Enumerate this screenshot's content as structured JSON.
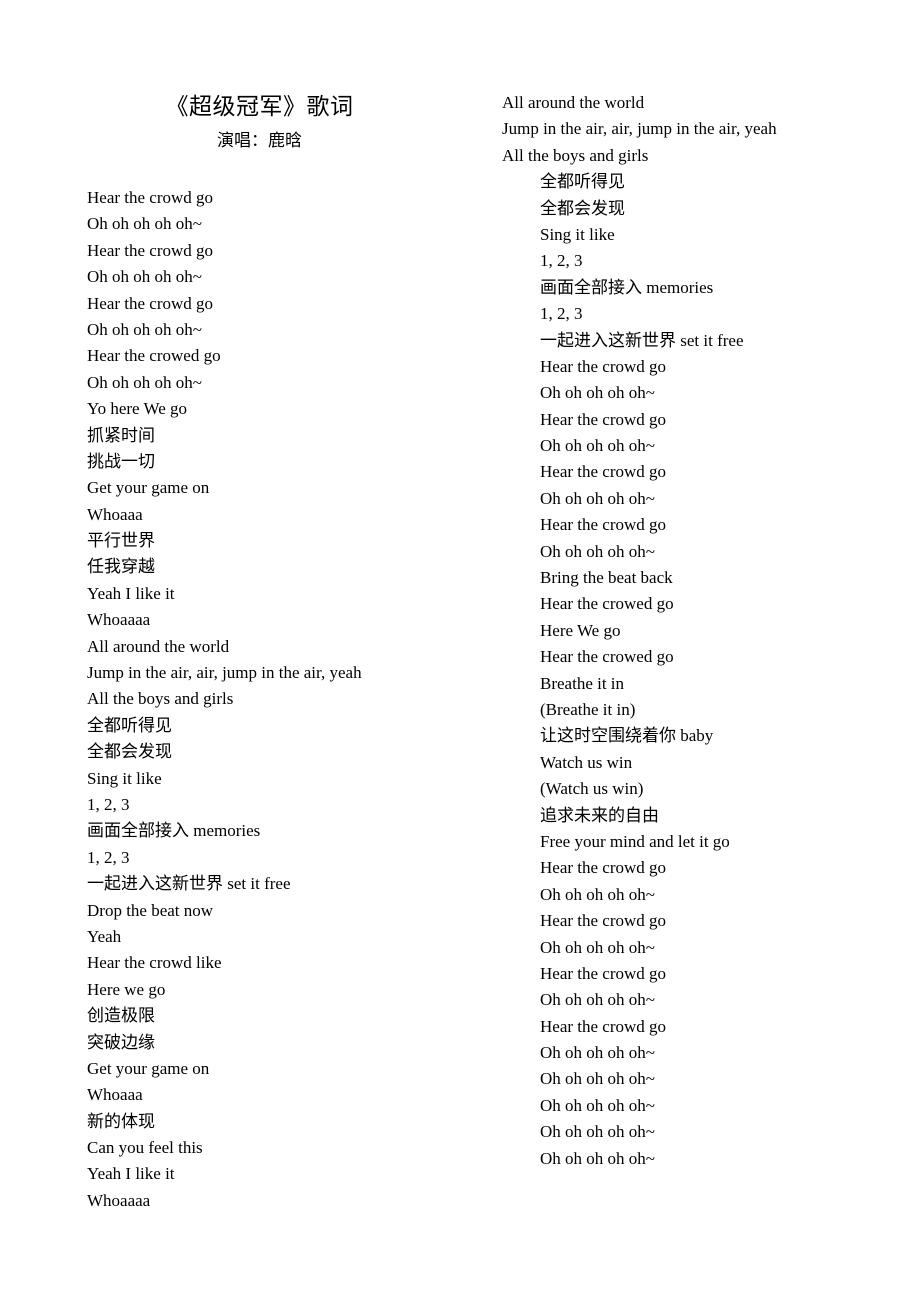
{
  "document": {
    "title": "《超级冠军》歌词",
    "subtitle": "演唱：鹿晗",
    "background_color": "#ffffff",
    "text_color": "#000000"
  },
  "left_column": {
    "lines": [
      {
        "text": "Hear the crowd go",
        "indent": false
      },
      {
        "text": "Oh oh oh oh oh~",
        "indent": false
      },
      {
        "text": "Hear the crowd go",
        "indent": false
      },
      {
        "text": "Oh oh oh oh oh~",
        "indent": false
      },
      {
        "text": "Hear the crowd go",
        "indent": false
      },
      {
        "text": "Oh oh oh oh oh~",
        "indent": false
      },
      {
        "text": "Hear the crowed go",
        "indent": false
      },
      {
        "text": "Oh oh oh oh oh~",
        "indent": false
      },
      {
        "text": "Yo here We go",
        "indent": false
      },
      {
        "text": "抓紧时间",
        "indent": false
      },
      {
        "text": "挑战一切",
        "indent": false
      },
      {
        "text": "Get your game on",
        "indent": false
      },
      {
        "text": "Whoaaa",
        "indent": false
      },
      {
        "text": "平行世界",
        "indent": false
      },
      {
        "text": "任我穿越",
        "indent": false
      },
      {
        "text": "Yeah I like it",
        "indent": false
      },
      {
        "text": "Whoaaaa",
        "indent": false
      },
      {
        "text": "All around the world",
        "indent": false
      },
      {
        "text": "Jump in the air, air, jump in the air, yeah",
        "indent": false
      },
      {
        "text": "All the boys and girls",
        "indent": false
      },
      {
        "text": "全都听得见",
        "indent": false
      },
      {
        "text": "全都会发现",
        "indent": false
      },
      {
        "text": "Sing it like",
        "indent": false
      },
      {
        "text": "1, 2, 3",
        "indent": false
      },
      {
        "text": "画面全部接入 memories",
        "indent": false
      },
      {
        "text": "1, 2, 3",
        "indent": false
      },
      {
        "text": "一起进入这新世界  set it free",
        "indent": false
      },
      {
        "text": "Drop the beat now",
        "indent": false
      },
      {
        "text": "Yeah",
        "indent": false
      },
      {
        "text": "Hear the crowd like",
        "indent": false
      },
      {
        "text": "Here we go",
        "indent": false
      },
      {
        "text": "创造极限",
        "indent": false
      },
      {
        "text": "突破边缘",
        "indent": false
      },
      {
        "text": "Get your game on",
        "indent": false
      },
      {
        "text": "Whoaaa",
        "indent": false
      },
      {
        "text": "新的体现",
        "indent": false
      },
      {
        "text": "Can you feel this",
        "indent": false
      },
      {
        "text": "Yeah I like it",
        "indent": false
      },
      {
        "text": "Whoaaaa",
        "indent": false
      }
    ]
  },
  "right_column": {
    "lines": [
      {
        "text": "All around the world",
        "indent": false
      },
      {
        "text": "Jump in the air, air, jump in the air, yeah",
        "indent": false
      },
      {
        "text": "All the boys and girls",
        "indent": false
      },
      {
        "text": "全都听得见",
        "indent": true
      },
      {
        "text": "全都会发现",
        "indent": true
      },
      {
        "text": "Sing it like",
        "indent": true
      },
      {
        "text": "1, 2, 3",
        "indent": true
      },
      {
        "text": "画面全部接入 memories",
        "indent": true
      },
      {
        "text": "1, 2, 3",
        "indent": true
      },
      {
        "text": "一起进入这新世界  set it free",
        "indent": true
      },
      {
        "text": "Hear the crowd go",
        "indent": true
      },
      {
        "text": "Oh oh oh oh oh~",
        "indent": true
      },
      {
        "text": "Hear the crowd go",
        "indent": true
      },
      {
        "text": "Oh oh oh oh oh~",
        "indent": true
      },
      {
        "text": "Hear the crowd go",
        "indent": true
      },
      {
        "text": "Oh oh oh oh oh~",
        "indent": true
      },
      {
        "text": "Hear the crowd go",
        "indent": true
      },
      {
        "text": "Oh oh oh oh oh~",
        "indent": true
      },
      {
        "text": "Bring the beat back",
        "indent": true
      },
      {
        "text": "Hear the crowed go",
        "indent": true
      },
      {
        "text": "Here We go",
        "indent": true
      },
      {
        "text": "Hear the crowed go",
        "indent": true
      },
      {
        "text": "Breathe it in",
        "indent": true
      },
      {
        "text": "(Breathe it in)",
        "indent": true
      },
      {
        "text": "让这时空围绕着你  baby",
        "indent": true
      },
      {
        "text": "Watch us win",
        "indent": true
      },
      {
        "text": "(Watch us win)",
        "indent": true
      },
      {
        "text": "追求未来的自由",
        "indent": true
      },
      {
        "text": "Free your mind and let it go",
        "indent": true
      },
      {
        "text": "Hear the crowd go",
        "indent": true
      },
      {
        "text": "Oh oh oh oh oh~",
        "indent": true
      },
      {
        "text": "Hear the crowd go",
        "indent": true
      },
      {
        "text": "Oh oh oh oh oh~",
        "indent": true
      },
      {
        "text": "Hear the crowd go",
        "indent": true
      },
      {
        "text": "Oh oh oh oh oh~",
        "indent": true
      },
      {
        "text": "Hear the crowd go",
        "indent": true
      },
      {
        "text": "Oh oh oh oh oh~",
        "indent": true
      },
      {
        "text": "Oh oh oh oh oh~",
        "indent": true
      },
      {
        "text": "Oh oh oh oh oh~",
        "indent": true
      },
      {
        "text": "Oh oh oh oh oh~",
        "indent": true
      },
      {
        "text": "Oh oh oh oh oh~",
        "indent": true
      }
    ]
  }
}
